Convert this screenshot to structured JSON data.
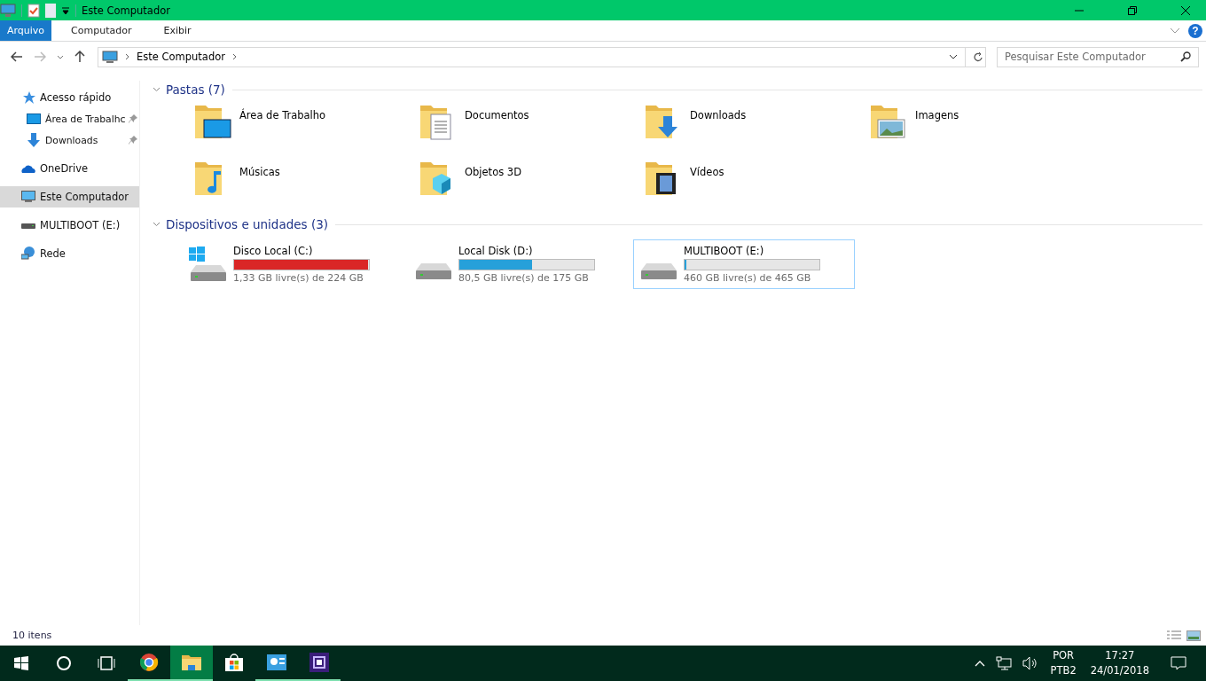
{
  "title_bar": {
    "title": "Este Computador"
  },
  "ribbon_tabs": [
    {
      "label": "Arquivo",
      "selected": true
    },
    {
      "label": "Computador",
      "selected": false
    },
    {
      "label": "Exibir",
      "selected": false
    }
  ],
  "help_button": "?",
  "address": {
    "path": [
      "Este Computador"
    ],
    "search": {
      "placeholder": "Pesquisar Este Computador"
    }
  },
  "sidebar": {
    "items": [
      {
        "label": "Acesso rápido",
        "kind": "quick-access",
        "selected": false,
        "children": [
          {
            "label": "Área de Trabalhc",
            "kind": "desktop",
            "selected": false,
            "pinned": true
          },
          {
            "label": "Downloads",
            "kind": "downloads",
            "selected": false,
            "pinned": true
          }
        ]
      },
      {
        "label": "OneDrive",
        "kind": "onedrive",
        "selected": false
      },
      {
        "label": "Este Computador",
        "kind": "computer",
        "selected": true
      },
      {
        "label": "MULTIBOOT (E:)",
        "kind": "drive",
        "selected": false
      },
      {
        "label": "Rede",
        "kind": "network",
        "selected": false
      }
    ]
  },
  "folders": {
    "title": "Pastas (7)",
    "expanded": true,
    "items": [
      {
        "label": "Área de Trabalho",
        "kind": "desktop"
      },
      {
        "label": "Documentos",
        "kind": "documents"
      },
      {
        "label": "Downloads",
        "kind": "downloads"
      },
      {
        "label": "Imagens",
        "kind": "pictures"
      },
      {
        "label": "Músicas",
        "kind": "music"
      },
      {
        "label": "Objetos 3D",
        "kind": "objects3d"
      },
      {
        "label": "Vídeos",
        "kind": "videos"
      }
    ]
  },
  "drives": {
    "title": "Dispositivos e unidades (3)",
    "expanded": true,
    "items": [
      {
        "label": "Disco Local (C:)",
        "kind": "system",
        "level": 0.994,
        "color": "#da2626",
        "free": "1,33 GB livre(s) de 224 GB",
        "selected": false
      },
      {
        "label": "Local Disk (D:)",
        "kind": "disk",
        "level": 0.54,
        "color": "#26a0da",
        "free": "80,5 GB livre(s) de 175 GB",
        "selected": false
      },
      {
        "label": "MULTIBOOT (E:)",
        "kind": "disk",
        "level": 0.011,
        "color": "#26a0da",
        "free": "460 GB livre(s) de 465 GB",
        "selected": true
      }
    ]
  },
  "status_bar": {
    "count": "10 itens"
  },
  "taskbar": {
    "apps": [
      {
        "kind": "chrome",
        "running": true,
        "selected": false
      },
      {
        "kind": "explorer",
        "running": true,
        "selected": true
      },
      {
        "kind": "store",
        "running": false,
        "selected": false
      },
      {
        "kind": "control-panel",
        "running": true,
        "selected": false
      },
      {
        "kind": "chip-app",
        "running": true,
        "selected": false
      }
    ],
    "language": "POR",
    "layout": "PTB2",
    "time": "17:27",
    "date": "24/01/2018"
  }
}
